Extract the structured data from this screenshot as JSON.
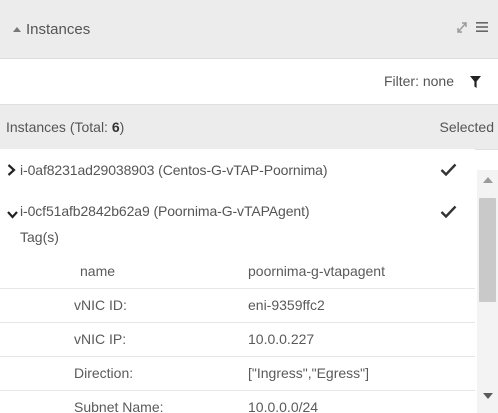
{
  "panel": {
    "title": "Instances"
  },
  "filter": {
    "label": "Filter: none"
  },
  "list_header": {
    "title_prefix": "Instances (Total: ",
    "total": "6",
    "title_suffix": ")",
    "selected_label": "Selected"
  },
  "instances": [
    {
      "label": "i-0af8231ad29038903 (Centos-G-vTAP-Poornima)",
      "expanded": false,
      "selected": true
    },
    {
      "label": "i-0cf51afb2842b62a9 (Poornima-G-vTAPAgent)",
      "expanded": true,
      "selected": true,
      "tags_label": "Tag(s)",
      "details": [
        {
          "key": "name",
          "value": "poornima-g-vtapagent"
        },
        {
          "key": "vNIC ID:",
          "value": "eni-9359ffc2"
        },
        {
          "key": "vNIC IP:",
          "value": "10.0.0.227"
        },
        {
          "key": "Direction:",
          "value": "[\"Ingress\",\"Egress\"]"
        },
        {
          "key": "Subnet Name:",
          "value": "10.0.0.0/24"
        }
      ]
    }
  ],
  "icons": {
    "collapse": "caret-up-icon",
    "expand": "expand-icon",
    "menu": "hamburger-menu-icon",
    "filter": "filter-funnel-icon",
    "row_collapsed": "chevron-right-icon",
    "row_expanded": "chevron-down-icon",
    "selected": "checkmark-icon"
  },
  "colors": {
    "header_bg": "#ececec",
    "text": "#555555",
    "icon_dark": "#222222"
  }
}
